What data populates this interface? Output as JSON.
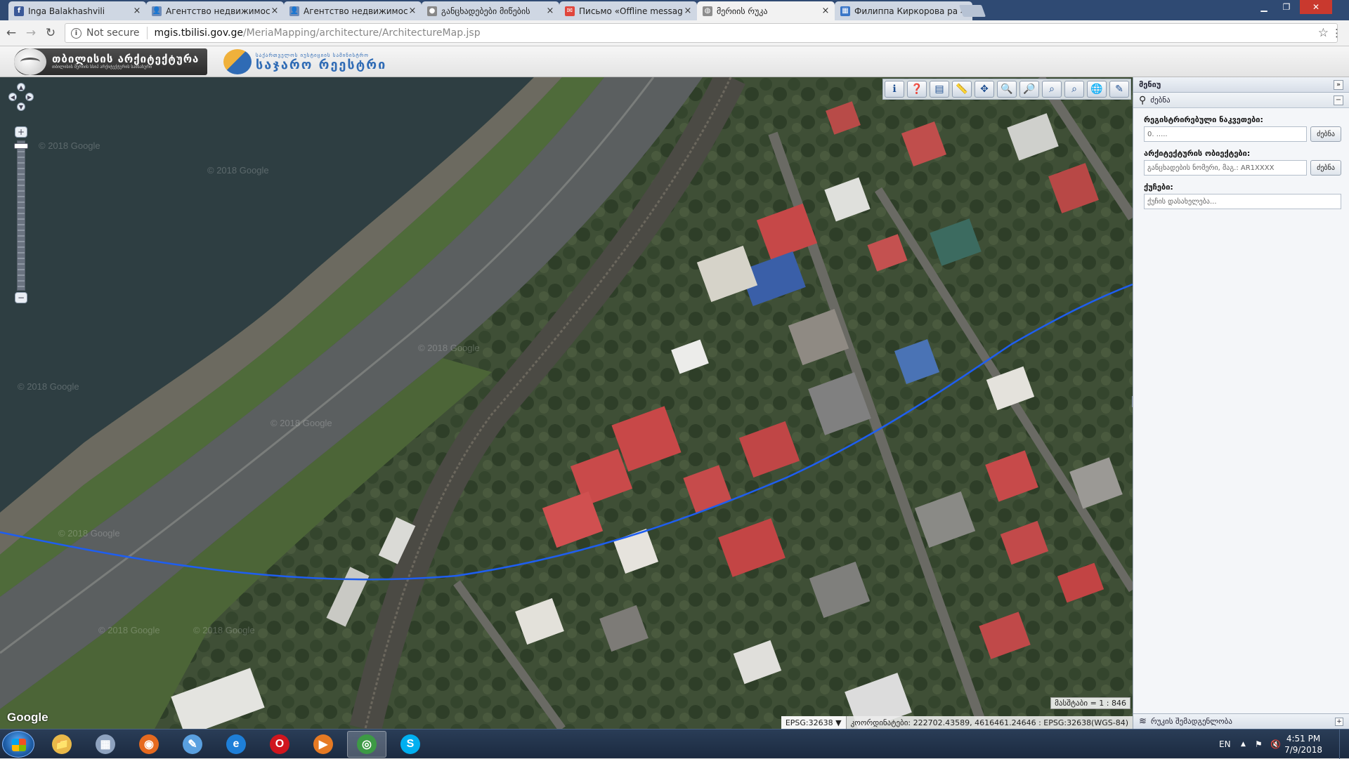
{
  "browser": {
    "tabs": [
      {
        "title": "Inga Balakhashvili",
        "icon": "facebook-icon",
        "color": "#3b5998",
        "glyph": "f"
      },
      {
        "title": "Агентство недвижимост",
        "icon": "user-icon",
        "color": "#6d8bb8",
        "glyph": "👤"
      },
      {
        "title": "Агентство недвижимост",
        "icon": "user-icon",
        "color": "#6d8bb8",
        "glyph": "👤"
      },
      {
        "title": "განცხადებები მიწების",
        "icon": "user-icon",
        "color": "#888888",
        "glyph": "●"
      },
      {
        "title": "Письмо «Offline messag",
        "icon": "mail-icon",
        "color": "#e0463c",
        "glyph": "✉"
      },
      {
        "title": "მერიის რუკა",
        "icon": "globe-icon",
        "color": "#8d8d8d",
        "glyph": "◍",
        "active": true
      },
      {
        "title": "Филиппа Киркорова ра",
        "icon": "page-icon",
        "color": "#3a76c8",
        "glyph": "▦"
      }
    ],
    "tab_close": "×",
    "not_secure": "Not secure",
    "url_host": "mgis.tbilisi.gov.ge",
    "url_path": "/MeriaMapping/architecture/ArchitectureMap.jsp"
  },
  "header": {
    "logo1_title": "თბილისის არქიტექტურა",
    "logo1_sub": "თბილისის მერიის სსიპ არქიტექტურის სამსახური",
    "logo2_title": "საჯარო რეესტრი",
    "logo2_sub": "საქართველოს იუსტიციის სამინისტრო"
  },
  "map": {
    "watermark": "© 2018 Google",
    "google_logo": "Google",
    "scale": "მასშტაბი = 1 : 846",
    "epsg": "EPSG:32638 ▼",
    "coordinates": "კოორდინატები: 222702.43589, 4616461.24646 : EPSG:32638(WGS-84)",
    "tools": [
      {
        "name": "info-tool",
        "glyph": "ℹ"
      },
      {
        "name": "identify-tool",
        "glyph": "❓"
      },
      {
        "name": "table-tool",
        "glyph": "▤"
      },
      {
        "name": "measure-tool",
        "glyph": "📏"
      },
      {
        "name": "pan-tool",
        "glyph": "✥"
      },
      {
        "name": "zoom-in-tool",
        "glyph": "🔍"
      },
      {
        "name": "zoom-out-tool",
        "glyph": "🔎"
      },
      {
        "name": "zoom-prev-tool",
        "glyph": "⌕"
      },
      {
        "name": "zoom-next-tool",
        "glyph": "⌕"
      },
      {
        "name": "full-extent-tool",
        "glyph": "🌐"
      },
      {
        "name": "draw-tool",
        "glyph": "✎"
      }
    ],
    "zoom_plus": "+",
    "zoom_minus": "−"
  },
  "panel": {
    "title": "მენიუ",
    "search_section": "ძებნა",
    "cadastral_label": "რეგისტრირებული ნაკვეთები:",
    "cadastral_value": "0. .....",
    "search_button": "ძებნა",
    "arch_label": "არქიტექტურის ობიექტები:",
    "arch_placeholder": "განცხადების ნომერი, მაგ.: AR1XXXX",
    "street_label": "ქუჩები:",
    "street_placeholder": "ქუჩის დასახელება...",
    "footer": "რუკის შემადგენლობა"
  },
  "taskbar": {
    "apps": [
      {
        "name": "file-explorer-icon",
        "color": "#e9b949",
        "glyph": "📁"
      },
      {
        "name": "calculator-icon",
        "color": "#8fa3bf",
        "glyph": "▦"
      },
      {
        "name": "firefox-icon",
        "color": "#e66a1f",
        "glyph": "◉"
      },
      {
        "name": "paint-icon",
        "color": "#5aa0e0",
        "glyph": "✎"
      },
      {
        "name": "internet-explorer-icon",
        "color": "#1e7fd8",
        "glyph": "e"
      },
      {
        "name": "opera-icon",
        "color": "#d0161e",
        "glyph": "O"
      },
      {
        "name": "media-player-icon",
        "color": "#e67a23",
        "glyph": "▶"
      },
      {
        "name": "chrome-icon",
        "color": "#3d9a45",
        "glyph": "◎",
        "active": true
      },
      {
        "name": "skype-icon",
        "color": "#00aff0",
        "glyph": "S"
      }
    ],
    "lang": "EN",
    "time": "4:51 PM",
    "date": "7/9/2018"
  }
}
